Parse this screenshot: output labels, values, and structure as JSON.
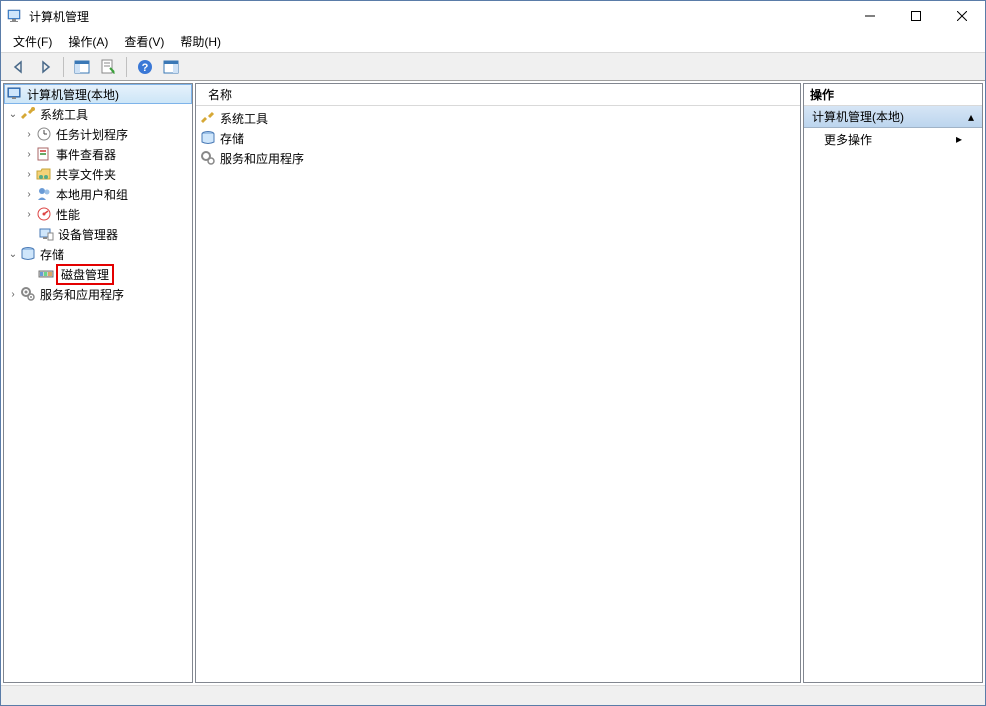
{
  "window": {
    "title": "计算机管理"
  },
  "menubar": {
    "file": "文件(F)",
    "action": "操作(A)",
    "view": "查看(V)",
    "help": "帮助(H)"
  },
  "tree": {
    "root": "计算机管理(本地)",
    "system_tools": "系统工具",
    "task_scheduler": "任务计划程序",
    "event_viewer": "事件查看器",
    "shared_folders": "共享文件夹",
    "local_users": "本地用户和组",
    "performance": "性能",
    "device_manager": "设备管理器",
    "storage": "存储",
    "disk_management": "磁盘管理",
    "services_apps": "服务和应用程序"
  },
  "list": {
    "header_name": "名称",
    "items": [
      "系统工具",
      "存储",
      "服务和应用程序"
    ]
  },
  "actions": {
    "header": "操作",
    "section": "计算机管理(本地)",
    "more": "更多操作"
  }
}
